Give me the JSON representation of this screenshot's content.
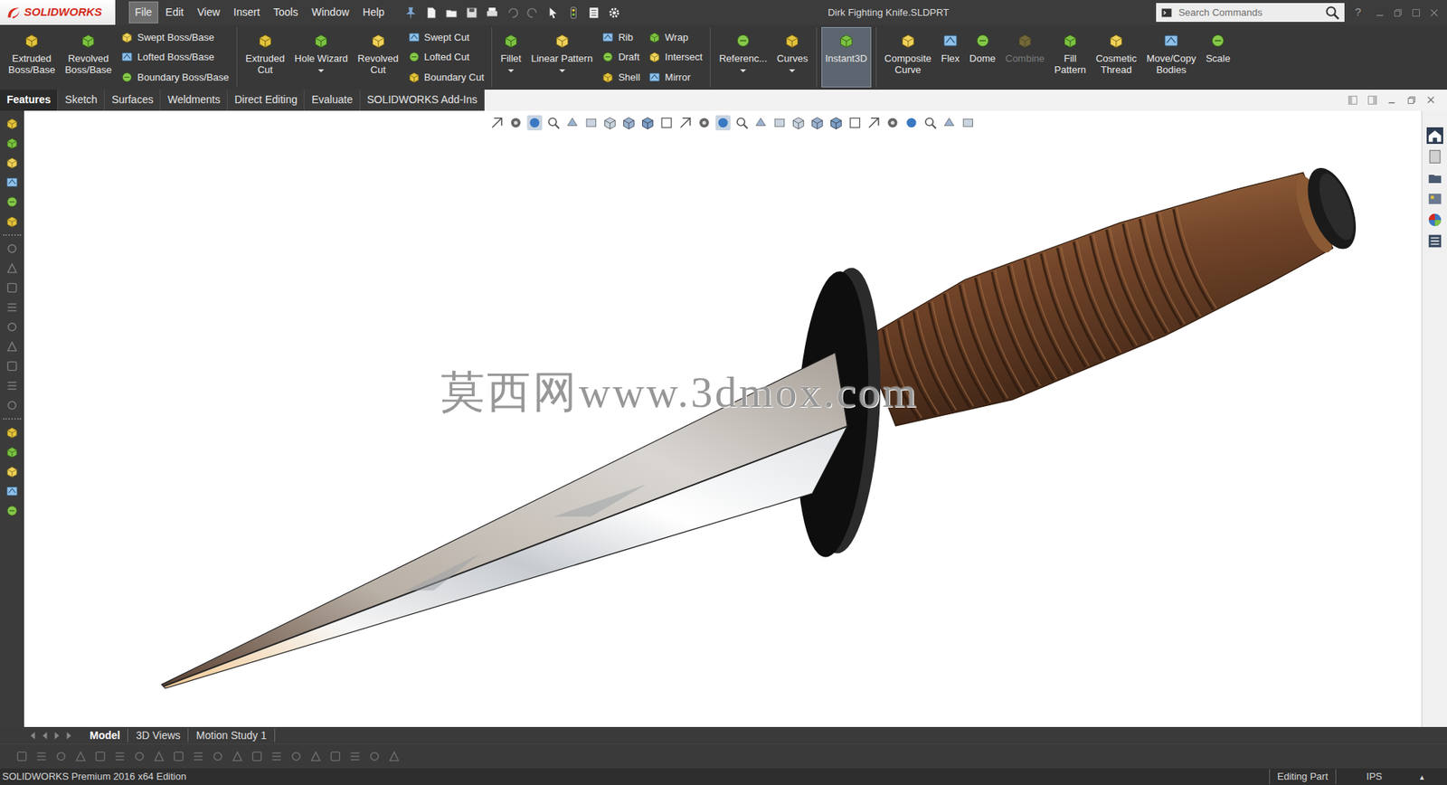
{
  "window": {
    "title": "Dirk Fighting Knife.SLDPRT",
    "logo": "SOLIDWORKS"
  },
  "menu": [
    {
      "label": "File",
      "selected": true
    },
    {
      "label": "Edit",
      "selected": false
    },
    {
      "label": "View",
      "selected": false
    },
    {
      "label": "Insert",
      "selected": false
    },
    {
      "label": "Tools",
      "selected": false
    },
    {
      "label": "Window",
      "selected": false
    },
    {
      "label": "Help",
      "selected": false
    }
  ],
  "search": {
    "placeholder": "Search Commands"
  },
  "help": "?",
  "ribbon": [
    [
      {
        "kind": "large",
        "lines": [
          "Extruded",
          "Boss/Base"
        ],
        "dropdown": false,
        "selected": false,
        "disabled": false
      },
      {
        "kind": "large",
        "lines": [
          "Revolved",
          "Boss/Base"
        ],
        "dropdown": false,
        "selected": false,
        "disabled": false
      },
      {
        "kind": "stack",
        "items": [
          {
            "label": "Swept Boss/Base"
          },
          {
            "label": "Lofted Boss/Base"
          },
          {
            "label": "Boundary Boss/Base"
          }
        ]
      }
    ],
    [
      {
        "kind": "large",
        "lines": [
          "Extruded",
          "Cut"
        ],
        "dropdown": false,
        "selected": false,
        "disabled": false
      },
      {
        "kind": "large",
        "lines": [
          "Hole Wizard"
        ],
        "dropdown": true,
        "selected": false,
        "disabled": false
      },
      {
        "kind": "large",
        "lines": [
          "Revolved",
          "Cut"
        ],
        "dropdown": false,
        "selected": false,
        "disabled": false
      },
      {
        "kind": "stack",
        "items": [
          {
            "label": "Swept Cut"
          },
          {
            "label": "Lofted Cut"
          },
          {
            "label": "Boundary Cut"
          }
        ]
      }
    ],
    [
      {
        "kind": "large",
        "lines": [
          "Fillet"
        ],
        "dropdown": true,
        "selected": false,
        "disabled": false
      },
      {
        "kind": "large",
        "lines": [
          "Linear Pattern"
        ],
        "dropdown": true,
        "selected": false,
        "disabled": false
      },
      {
        "kind": "stack",
        "items": [
          {
            "label": "Rib"
          },
          {
            "label": "Draft"
          },
          {
            "label": "Shell"
          }
        ]
      },
      {
        "kind": "stack",
        "items": [
          {
            "label": "Wrap"
          },
          {
            "label": "Intersect"
          },
          {
            "label": "Mirror"
          }
        ]
      }
    ],
    [
      {
        "kind": "large",
        "lines": [
          "Referenc..."
        ],
        "dropdown": true,
        "selected": false,
        "disabled": false
      },
      {
        "kind": "large",
        "lines": [
          "Curves"
        ],
        "dropdown": true,
        "selected": false,
        "disabled": false
      }
    ],
    [
      {
        "kind": "large",
        "lines": [
          "Instant3D"
        ],
        "dropdown": false,
        "selected": true,
        "disabled": false
      }
    ],
    [
      {
        "kind": "large",
        "lines": [
          "Composite",
          "Curve"
        ],
        "dropdown": false,
        "selected": false,
        "disabled": false
      },
      {
        "kind": "large",
        "lines": [
          "Flex"
        ],
        "dropdown": false,
        "selected": false,
        "disabled": false
      },
      {
        "kind": "large",
        "lines": [
          "Dome"
        ],
        "dropdown": false,
        "selected": false,
        "disabled": false
      },
      {
        "kind": "large",
        "lines": [
          "Combine"
        ],
        "dropdown": false,
        "selected": false,
        "disabled": true
      },
      {
        "kind": "large",
        "lines": [
          "Fill",
          "Pattern"
        ],
        "dropdown": false,
        "selected": false,
        "disabled": false
      },
      {
        "kind": "large",
        "lines": [
          "Cosmetic",
          "Thread"
        ],
        "dropdown": false,
        "selected": false,
        "disabled": false
      },
      {
        "kind": "large",
        "lines": [
          "Move/Copy",
          "Bodies"
        ],
        "dropdown": false,
        "selected": false,
        "disabled": false
      },
      {
        "kind": "large",
        "lines": [
          "Scale"
        ],
        "dropdown": false,
        "selected": false,
        "disabled": false
      }
    ]
  ],
  "tabs": [
    {
      "label": "Features",
      "selected": true
    },
    {
      "label": "Sketch",
      "selected": false
    },
    {
      "label": "Surfaces",
      "selected": false
    },
    {
      "label": "Weldments",
      "selected": false
    },
    {
      "label": "Direct Editing",
      "selected": false
    },
    {
      "label": "Evaluate",
      "selected": false
    },
    {
      "label": "SOLIDWORKS Add-Ins",
      "selected": false
    }
  ],
  "viewport": {
    "watermark": "莫西网www.3dmox.com"
  },
  "bottom_tabs": [
    {
      "label": "Model",
      "selected": true
    },
    {
      "label": "3D Views",
      "selected": false
    },
    {
      "label": "Motion Study 1",
      "selected": false
    }
  ],
  "status_bar": {
    "edition": "SOLIDWORKS Premium 2016 x64 Edition",
    "mode": "Editing Part",
    "units": "IPS",
    "units_menu": "▴"
  }
}
